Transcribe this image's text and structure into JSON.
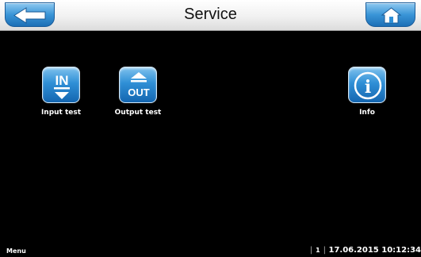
{
  "header": {
    "title": "Service",
    "back_icon": "back-arrow-icon",
    "home_icon": "home-icon"
  },
  "tiles": [
    {
      "label": "Input test",
      "icon": "input-test-icon",
      "icon_text": "IN"
    },
    {
      "label": "Output test",
      "icon": "output-test-icon",
      "icon_text": "OUT"
    },
    {
      "label": "Info",
      "icon": "info-icon",
      "icon_text": "i"
    }
  ],
  "footer": {
    "menu_label": "Menu",
    "separator": "|",
    "page_number": "1",
    "datetime": "17.06.2015 10:12:34"
  },
  "colors": {
    "accent_blue": "#2f8fd6",
    "background": "#000000",
    "topbar": "#f1f1f1"
  }
}
